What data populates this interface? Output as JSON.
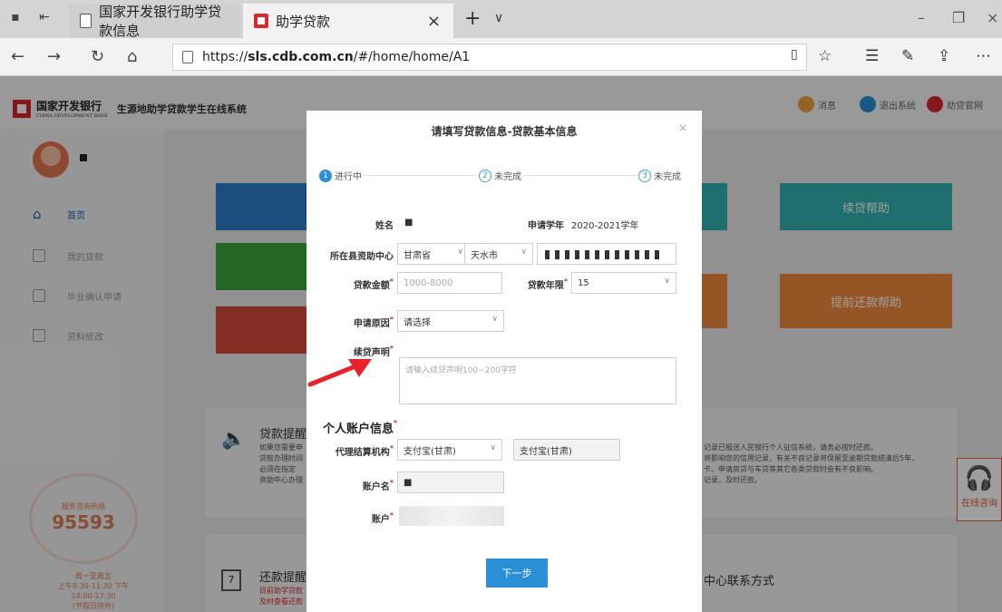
{
  "browser": {
    "tabs": [
      {
        "title": "国家开发银行助学贷款信息",
        "active": false
      },
      {
        "title": "助学贷款",
        "active": true
      }
    ],
    "url_prefix": "https://",
    "url_host": "sls.cdb.com.cn",
    "url_path": "/#/home/home/A1"
  },
  "site": {
    "logo_cn": "国家开发银行",
    "logo_en": "CHINA DEVELOPMENT BANK",
    "system_name": "生源地助学贷款学生在线系统",
    "header_buttons": [
      {
        "label": "消息",
        "color": "#f0a23a",
        "icon": "bell-icon"
      },
      {
        "label": "退出系统",
        "color": "#2b8fd6",
        "icon": "logout-icon"
      },
      {
        "label": "助贷官网",
        "color": "#d9282f",
        "icon": "home-icon"
      }
    ]
  },
  "sidebar": {
    "username": "■",
    "items": [
      {
        "label": "首页",
        "active": true,
        "icon": "home-icon"
      },
      {
        "label": "我的贷款",
        "active": false,
        "icon": "document-icon"
      },
      {
        "label": "毕业确认申请",
        "active": false,
        "icon": "monitor-icon"
      },
      {
        "label": "资料修改",
        "active": false,
        "icon": "edit-icon"
      }
    ],
    "hotline_label": "服务咨询热线",
    "hotline": "95593",
    "hotline_foot": [
      "周一至周五",
      "上午8:30-11:30 下午14:00-17:30",
      "(节假日除外)"
    ]
  },
  "tiles": [
    {
      "label": "",
      "color": "#2d7fc9"
    },
    {
      "label": "",
      "color": "#3aa53a"
    },
    {
      "label": "",
      "color": "#d64a3c"
    },
    {
      "label": "续贷帮助",
      "color": "#33b4b2"
    },
    {
      "label": "提前还款帮助",
      "color": "#f08a3c"
    }
  ],
  "notices": {
    "loan_title": "贷款提醒",
    "loan_lines": [
      "如果您需要申",
      "贷款办理时间",
      "必须在指定",
      "资助中心办理"
    ],
    "credit_lines": [
      "记录已报送人民银行个人征信系统，请务必按时还款。",
      "将影响您的信用记录，有关不良记录将保留至逾期贷款结清后5年，",
      "卡、申请房贷与车贷等其它各类贷款时会有不良影响。",
      "记录，及时还款。"
    ],
    "repay_title": "还款提醒",
    "repay_lines": [
      "目前助学贷款",
      "及时查看还款"
    ],
    "calendar_day": "7",
    "contact_title": "中心联系方式"
  },
  "chat": {
    "label": "在线咨询"
  },
  "modal": {
    "title": "请填写贷款信息-贷款基本信息",
    "close": "×",
    "steps": [
      {
        "num": "1",
        "label": "进行中",
        "current": true
      },
      {
        "num": "2",
        "label": "未完成",
        "current": false
      },
      {
        "num": "3",
        "label": "未完成",
        "current": false
      }
    ],
    "fields": {
      "name_label": "姓名",
      "name_value": "■",
      "year_label": "申请学年",
      "year_value": "2020-2021学年",
      "center_label": "所在县资助中心",
      "province": "甘肃省",
      "city": "天水市",
      "amount_label": "贷款金额",
      "amount_placeholder": "1000-8000",
      "term_label": "贷款年限",
      "term_value": "15",
      "reason_label": "申请原因",
      "reason_value": "请选择",
      "statement_label": "续贷声明",
      "statement_placeholder": "请输入续贷声明100~200字符",
      "account_section": "个人账户信息",
      "agency_label": "代理结算机构",
      "agency_value": "支付宝(甘肃)",
      "agency_display": "支付宝(甘肃)",
      "account_name_label": "账户名",
      "account_name_value": "■",
      "account_label": "账户"
    },
    "next_button": "下一步"
  }
}
